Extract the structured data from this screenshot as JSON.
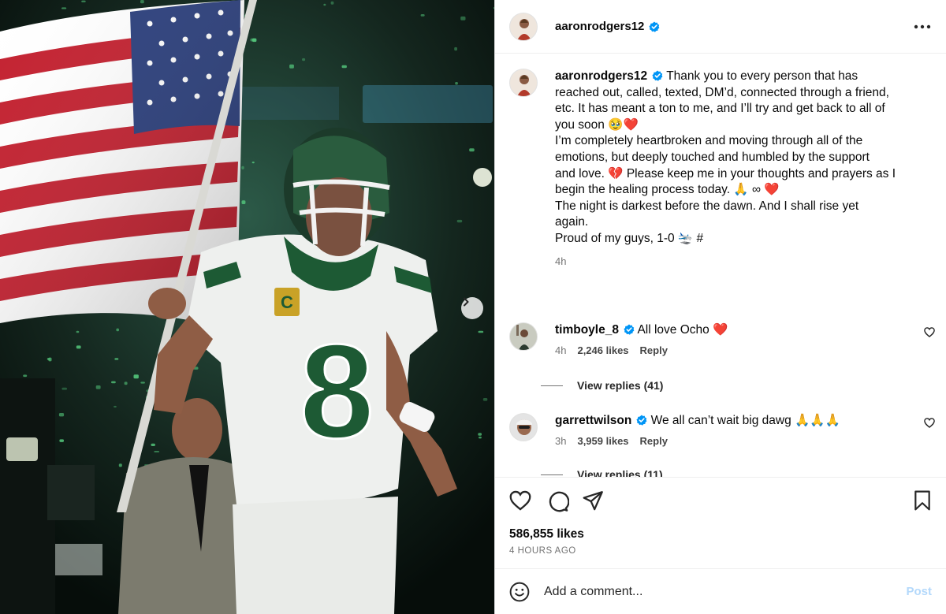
{
  "post": {
    "username": "aaronrodgers12",
    "caption_lines": [
      "Thank you to every person that has",
      "reached out, called, texted, DM’d, connected through a friend,",
      "etc. It has meant a ton to me, and I’ll try and get back to all of",
      "you soon 🥹❤️",
      "I’m completely heartbroken and moving through all of the",
      "emotions, but deeply touched and humbled by the support",
      "and love. 💔 Please keep me in your thoughts and prayers as I",
      "begin the healing process today. 🙏 ∞ ❤️",
      "",
      "The night is darkest before the dawn. And I shall rise yet",
      "again.",
      "",
      "Proud of my guys, 1-0 🛬 #"
    ],
    "caption_age": "4h",
    "likes": "586,855 likes",
    "timestamp": "4 HOURS AGO"
  },
  "comments": [
    {
      "username": "timboyle_8",
      "text": "All love Ocho ❤️",
      "age": "4h",
      "likes": "2,246 likes",
      "reply_label": "Reply",
      "view_replies": "View replies (41)"
    },
    {
      "username": "garrettwilson",
      "text": "We all can’t wait big dawg 🙏🙏🙏",
      "age": "3h",
      "likes": "3,959 likes",
      "reply_label": "Reply",
      "view_replies": "View replies (11)"
    }
  ],
  "composer": {
    "placeholder": "Add a comment...",
    "post_label": "Post"
  },
  "icons": {
    "header": [
      "verified-badge-icon",
      "more-options-icon"
    ],
    "actions": [
      "heart-icon",
      "comment-icon",
      "share-icon",
      "bookmark-icon"
    ],
    "composer": [
      "emoji-icon"
    ],
    "carousel": [
      "chevron-right-icon"
    ]
  },
  "colors": {
    "verified": "#0095f6",
    "post_disabled": "#b3d8fb",
    "jersey_green": "#1d5a34"
  }
}
